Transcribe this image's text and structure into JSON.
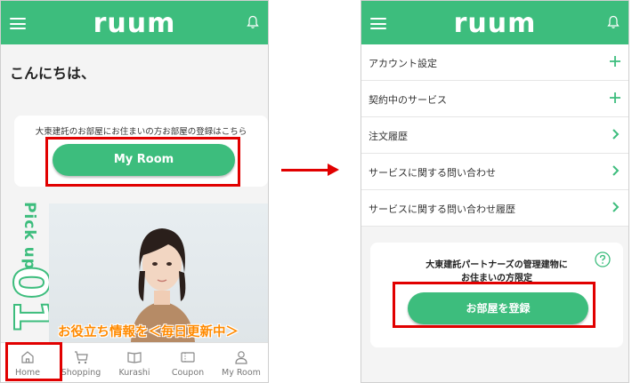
{
  "brand": {
    "logo_text": "ruum",
    "accent_color": "#3dbd7d",
    "highlight_color": "#e10000",
    "banner_text_color": "#ff8a00"
  },
  "screen_a": {
    "greeting": "こんにちは、",
    "registration_text": "大東建託のお部屋にお住まいの方お部屋の登録はこちら",
    "my_room_button": "My Room",
    "pickup_label": "Pick up",
    "pickup_number": "01",
    "banner_caption": "お役立ち情報を＜毎日更新中＞",
    "bottom_nav": [
      {
        "label": "Home",
        "icon": "home-icon"
      },
      {
        "label": "Shopping",
        "icon": "cart-icon"
      },
      {
        "label": "Kurashi",
        "icon": "book-icon"
      },
      {
        "label": "Coupon",
        "icon": "coupon-icon"
      },
      {
        "label": "My Room",
        "icon": "person-icon"
      }
    ]
  },
  "screen_b": {
    "menu": [
      {
        "label": "アカウント設定",
        "icon": "plus-icon"
      },
      {
        "label": "契約中のサービス",
        "icon": "plus-icon"
      },
      {
        "label": "注文履歴",
        "icon": "chevron-right-icon"
      },
      {
        "label": "サービスに関する問い合わせ",
        "icon": "chevron-right-icon"
      },
      {
        "label": "サービスに関する問い合わせ履歴",
        "icon": "chevron-right-icon"
      }
    ],
    "partner_text_line1": "大東建託パートナーズの管理建物に",
    "partner_text_line2": "お住まいの方限定",
    "register_button": "お部屋を登録"
  }
}
